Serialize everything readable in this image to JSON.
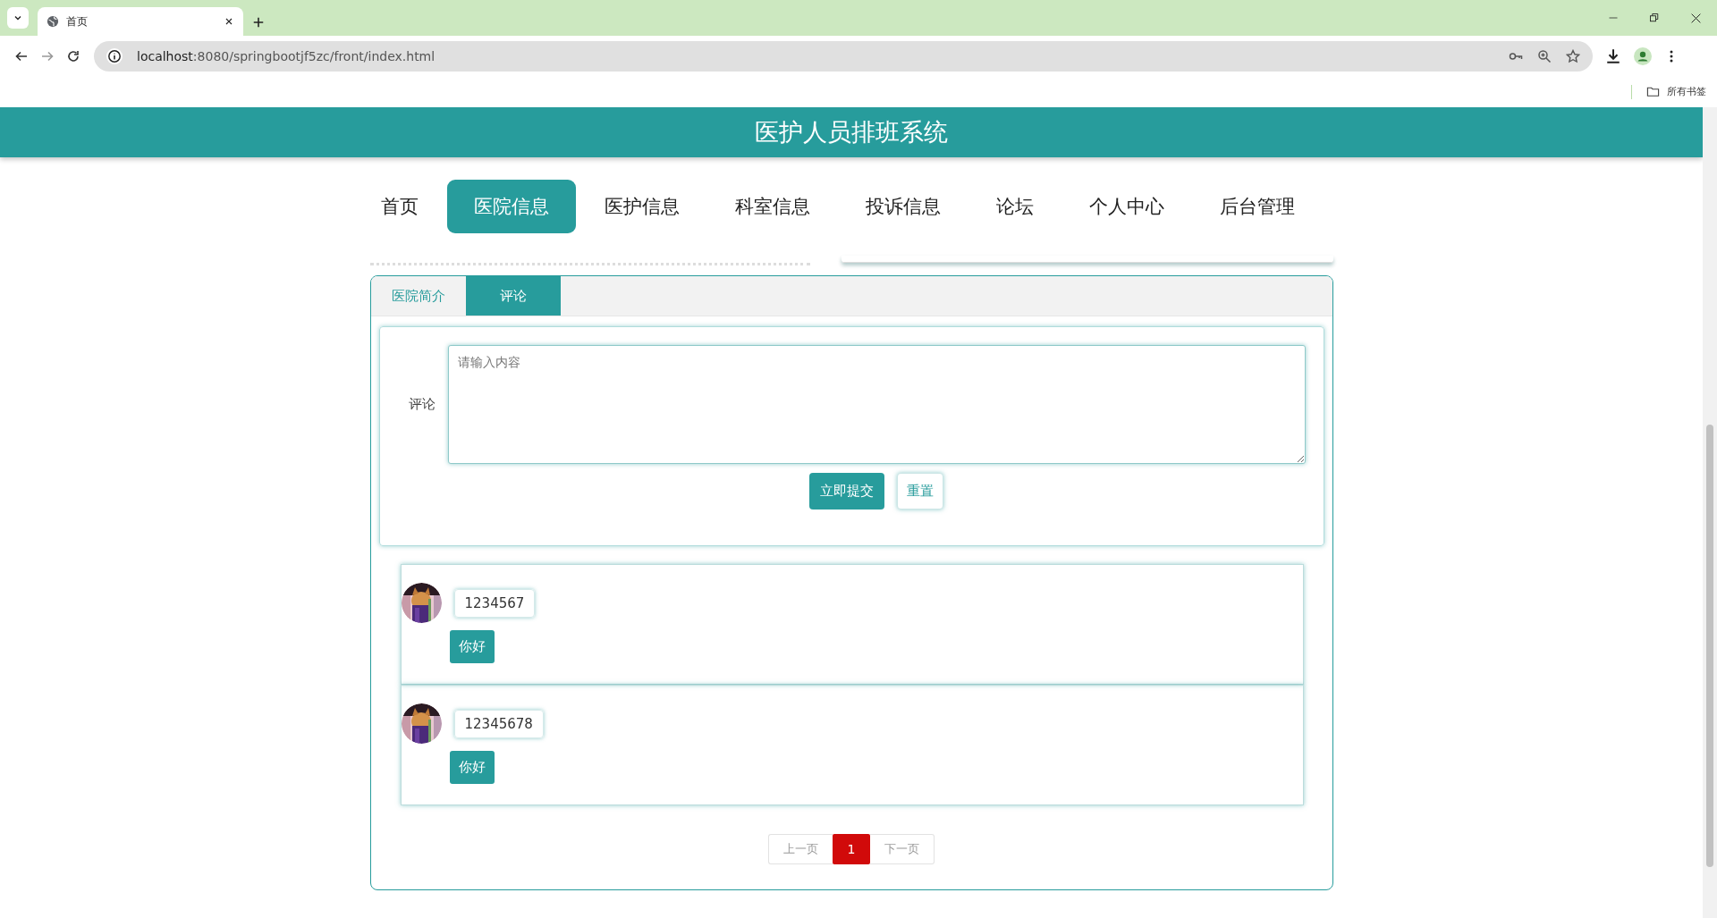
{
  "browser": {
    "tab_title": "首页",
    "url_host": "localhost",
    "url_path": ":8080/springbootjf5zc/front/index.html",
    "bookmarks_label": "所有书签"
  },
  "header": {
    "title": "医护人员排班系统"
  },
  "nav": [
    {
      "label": "首页",
      "selected": false
    },
    {
      "label": "医院信息",
      "selected": true
    },
    {
      "label": "医护信息",
      "selected": false
    },
    {
      "label": "科室信息",
      "selected": false
    },
    {
      "label": "投诉信息",
      "selected": false
    },
    {
      "label": "论坛",
      "selected": false
    },
    {
      "label": "个人中心",
      "selected": false
    },
    {
      "label": "后台管理",
      "selected": false
    }
  ],
  "detail_tabs": [
    {
      "label": "医院简介",
      "selected": false
    },
    {
      "label": "评论",
      "selected": true
    }
  ],
  "comment_form": {
    "label": "评论",
    "placeholder": "请输入内容",
    "submit": "立即提交",
    "reset": "重置"
  },
  "comments": [
    {
      "user": "1234567",
      "text": "你好"
    },
    {
      "user": "12345678",
      "text": "你好"
    }
  ],
  "pagination": {
    "prev": {
      "label": "上一页",
      "disabled": true
    },
    "pages": [
      {
        "label": "1",
        "selected": true
      }
    ],
    "next": {
      "label": "下一页",
      "disabled": true
    }
  }
}
